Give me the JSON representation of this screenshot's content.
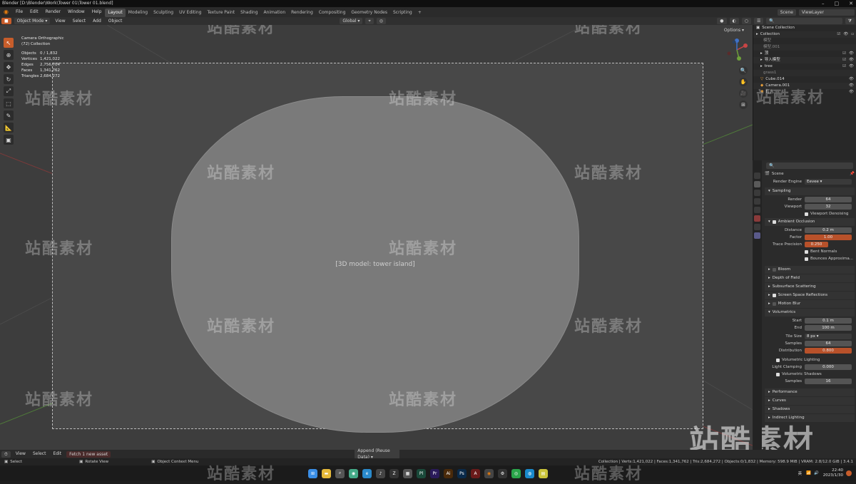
{
  "window": {
    "title": "Blender [D:\\Blender\\Work\\Tower 01\\Tower 01.blend]"
  },
  "menu": [
    "File",
    "Edit",
    "Render",
    "Window",
    "Help"
  ],
  "workspaces": [
    "Layout",
    "Modeling",
    "Sculpting",
    "UV Editing",
    "Texture Paint",
    "Shading",
    "Animation",
    "Rendering",
    "Compositing",
    "Geometry Nodes",
    "Scripting"
  ],
  "active_workspace": "Layout",
  "scene_field": "Scene",
  "viewlayer_field": "ViewLayer",
  "viewport_header": {
    "mode": "Object Mode",
    "view": "View",
    "select": "Select",
    "add": "Add",
    "object": "Object",
    "transform": "Global",
    "options": "Options"
  },
  "overlay": {
    "camera": "Camera Orthographic",
    "collection": "(72) Collection",
    "stats": [
      {
        "k": "Objects",
        "v": "0 / 1,832"
      },
      {
        "k": "Vertices",
        "v": "1,421,022"
      },
      {
        "k": "Edges",
        "v": "2,756,704"
      },
      {
        "k": "Faces",
        "v": "1,341,762"
      },
      {
        "k": "Triangles",
        "v": "2,684,272"
      }
    ]
  },
  "outliner": {
    "title": "Scene Collection",
    "items": [
      "Collection",
      "模型",
      "模型.001",
      "顶",
      "导入模型",
      "tree",
      "grass1",
      "Cube.014",
      "Camera.001",
      "灯光"
    ]
  },
  "properties": {
    "scene_label": "Scene",
    "render_engine_label": "Render Engine",
    "render_engine": "Eevee",
    "sampling": {
      "title": "Sampling",
      "render_label": "Render",
      "render": "64",
      "viewport_label": "Viewport",
      "viewport": "32",
      "denoise": "Viewport Denoising"
    },
    "ao": {
      "title": "Ambient Occlusion",
      "distance_label": "Distance",
      "distance": "0.2 m",
      "factor_label": "Factor",
      "factor": "1.00",
      "trace_label": "Trace Precision",
      "trace": "0.250",
      "bent": "Bent Normals",
      "bounces": "Bounces Approxima..."
    },
    "panels": [
      "Bloom",
      "Depth of Field",
      "Subsurface Scattering",
      "Screen Space Reflections",
      "Motion Blur"
    ],
    "volumetrics": {
      "title": "Volumetrics",
      "start_label": "Start",
      "start": "0.1 m",
      "end_label": "End",
      "end": "100 m",
      "tile_label": "Tile Size",
      "tile": "8 px",
      "samples_label": "Samples",
      "samples": "64",
      "dist_label": "Distribution",
      "dist": "0.800",
      "lighting": "Volumetric Lighting",
      "clamp_label": "Light Clamping",
      "clamp": "0.000",
      "shadows": "Volumetric Shadows",
      "shadow_samples_label": "Samples",
      "shadow_samples": "16"
    },
    "more": [
      "Performance",
      "Curves",
      "Shadows",
      "Indirect Lighting"
    ]
  },
  "timeline": {
    "view": "View",
    "select": "Select",
    "edit": "Edit",
    "fetch": "Fetch 1 new asset",
    "append": "Append (Reuse Data)"
  },
  "status": {
    "select": "Select",
    "rotate": "Rotate View",
    "context": "Object Context Menu",
    "info": "Collection | Verts:1,421,022 | Faces:1,341,762 | Tris:2,684,272 | Objects:0/1,832 | Memory: 598.9 MiB | VRAM: 2.8/12.0 GiB | 3.4.1"
  },
  "taskbar": {
    "lang": "英",
    "time": "22:40",
    "date": "2023/1/30"
  },
  "watermark": "站酷素材",
  "viewport_image_label": "[3D model: tower island]"
}
